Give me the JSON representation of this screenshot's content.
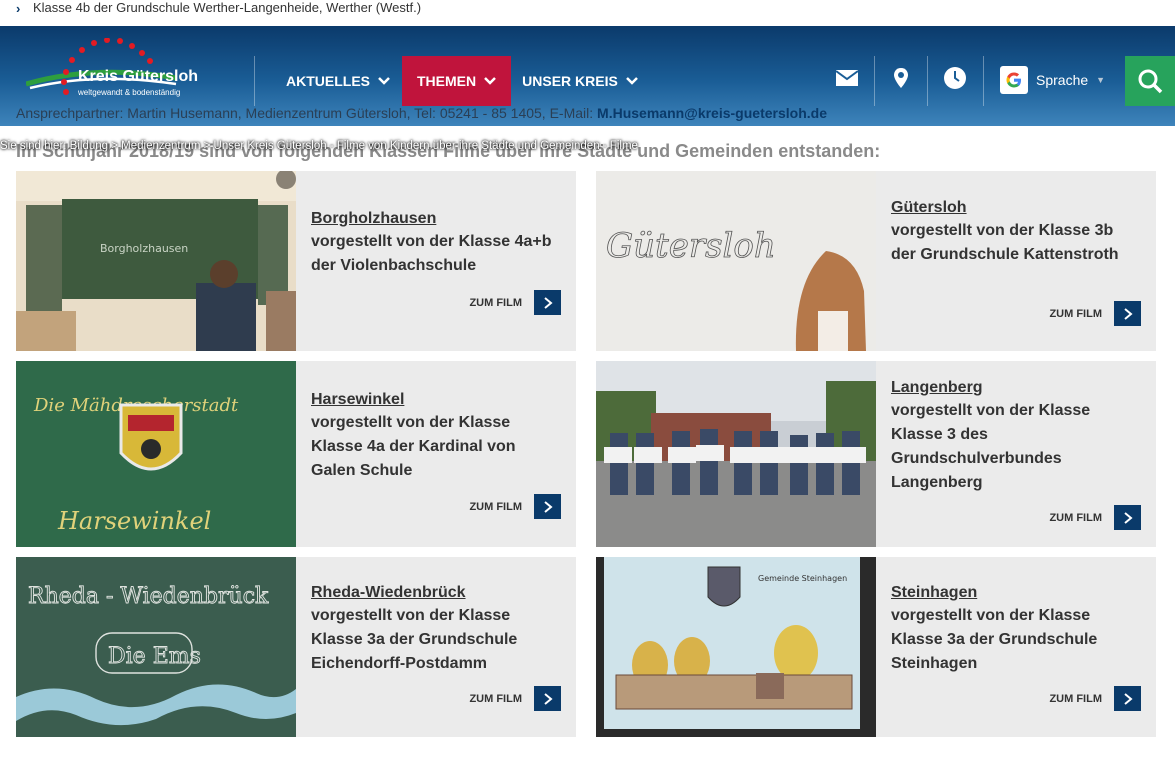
{
  "top_bar": {
    "text": "Klasse 4b der Grundschule Werther-Langenheide, Werther (Westf.)"
  },
  "logo": {
    "name": "Kreis Gütersloh",
    "tagline": "weltgewandt & bodenständig"
  },
  "nav": [
    {
      "label": "AKTUELLES",
      "active": false
    },
    {
      "label": "THEMEN",
      "active": true
    },
    {
      "label": "UNSER KREIS",
      "active": false
    }
  ],
  "language": {
    "label": "Sprache"
  },
  "contact": {
    "text": "Ansprechpartner: Martin Husemann, Medienzentrum Gütersloh, Tel: 05241 - 85 1405, E-Mail: ",
    "email": "M.Husemann@kreis-guetersloh.de"
  },
  "breadcrumb": "Sie sind hier: Bildung > Medienzentrum > Unser Kreis Gütersloh - Filme von Kindern über ihre Städte und Gemeinden - Filme",
  "intro": "Im Schuljahr 2018/19 sind von folgenden Klassen Filme über ihre Städte und Gemeinden entstanden:",
  "cards": [
    {
      "city": "Borgholzhausen",
      "desc": "vorgestellt von der Klasse 4a+b der Violenbachschule",
      "button": "ZUM FILM",
      "thumb_text": "Borgholzhausen"
    },
    {
      "city": "Gütersloh",
      "desc": "vorgestellt von der Klasse 3b der Grundschule Kattenstroth",
      "button": "ZUM FILM",
      "thumb_text": "Gütersloh"
    },
    {
      "city": "Harsewinkel",
      "desc": "vorgestellt von der Klasse Klasse 4a der Kardinal von Galen Schule",
      "button": "ZUM FILM",
      "thumb_text": "Die Mähdrescherstadt",
      "thumb_text2": "Harsewinkel"
    },
    {
      "city": "Langenberg",
      "desc": "vorgestellt von der Klasse Klasse 3 des Grundschulverbundes Langenberg",
      "button": "ZUM FILM"
    },
    {
      "city": "Rheda-Wiedenbrück",
      "desc": "vorgestellt von der Klasse Klasse 3a der Grundschule Eichendorff-Postdamm",
      "button": "ZUM FILM",
      "thumb_text": "Rheda - Wiedenbrück",
      "thumb_text2": "Die Ems"
    },
    {
      "city": "Steinhagen",
      "desc": "vorgestellt von der Klasse Klasse 3a der Grundschule Steinhagen",
      "button": "ZUM FILM",
      "thumb_text": "Gemeinde Steinhagen"
    }
  ],
  "colors": {
    "header_dark": "#0b3a6b",
    "accent_red": "#c0143c",
    "search_green": "#27a35c",
    "button_navy": "#0a3a6a",
    "card_bg": "#ebebeb"
  }
}
